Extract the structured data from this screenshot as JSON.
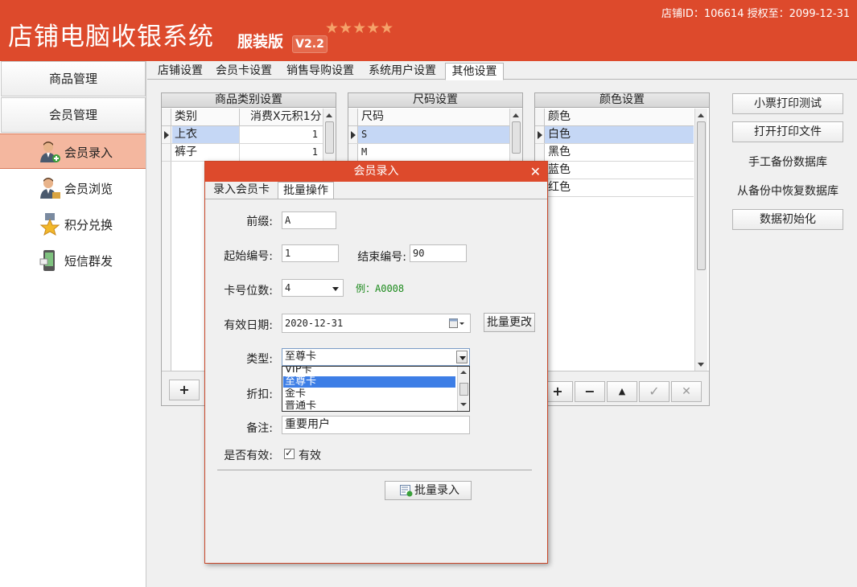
{
  "header": {
    "title": "店铺电脑收银系统",
    "edition": "服装版",
    "version": "V2.2",
    "stars": "★★★★★",
    "store_info": "店铺ID：106614 授权至：2099-12-31"
  },
  "sidebar": {
    "product_mgmt": "商品管理",
    "member_mgmt": "会员管理",
    "items": [
      {
        "label": "会员录入",
        "icon": "member-add-icon"
      },
      {
        "label": "会员浏览",
        "icon": "member-browse-icon"
      },
      {
        "label": "积分兑换",
        "icon": "medal-icon"
      },
      {
        "label": "短信群发",
        "icon": "phone-icon"
      }
    ]
  },
  "tabs": [
    "店铺设置",
    "会员卡设置",
    "销售导购设置",
    "系统用户设置",
    "其他设置"
  ],
  "category_panel": {
    "title": "商品类别设置",
    "col1": "类别",
    "col2": "消费X元积1分",
    "rows": [
      {
        "name": "上衣",
        "value": "1"
      },
      {
        "name": "裤子",
        "value": "1"
      }
    ]
  },
  "size_panel": {
    "title": "尺码设置",
    "col": "尺码",
    "rows": [
      "S",
      "M"
    ]
  },
  "color_panel": {
    "title": "颜色设置",
    "col": "颜色",
    "rows": [
      "白色",
      "黑色",
      "蓝色",
      "红色"
    ]
  },
  "toolbar_symbols": {
    "add": "+",
    "remove": "−",
    "up": "▲",
    "confirm": "✓",
    "cancel": "✕"
  },
  "right_actions": {
    "print_test": "小票打印测试",
    "open_print_file": "打开打印文件",
    "manual_backup": "手工备份数据库",
    "restore_backup": "从备份中恢复数据库",
    "data_init": "数据初始化"
  },
  "dialog": {
    "title": "会员录入",
    "close": "✕",
    "tabs": [
      "录入会员卡",
      "批量操作"
    ],
    "prefix_label": "前缀:",
    "prefix_value": "A",
    "start_label": "起始编号:",
    "start_value": "1",
    "end_label": "结束编号:",
    "end_value": "90",
    "digits_label": "卡号位数:",
    "digits_value": "4",
    "example": "例：A0008",
    "expiry_label": "有效日期:",
    "expiry_value": "2020-12-31",
    "batch_change": "批量更改",
    "type_label": "类型:",
    "type_value": "至尊卡",
    "type_options": [
      "VIP卡",
      "至尊卡",
      "金卡",
      "普通卡"
    ],
    "discount_label": "折扣:",
    "note_label": "备注:",
    "note_value": "重要用户",
    "valid_label": "是否有效:",
    "valid_text": "有效",
    "valid_checked": true,
    "submit": "批量录入"
  }
}
